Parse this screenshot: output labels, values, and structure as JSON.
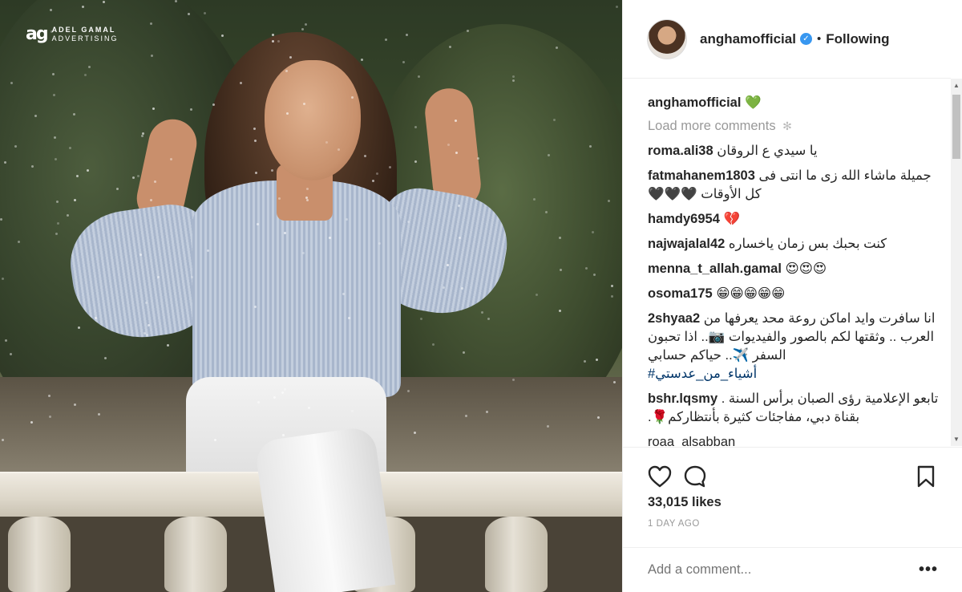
{
  "photo": {
    "brand_mark": "ag",
    "brand_line1": "ADEL GAMAL",
    "brand_line2": "ADVERTISING"
  },
  "header": {
    "username": "anghamofficial",
    "separator": "•",
    "follow_label": "Following"
  },
  "caption": {
    "username": "anghamofficial",
    "text": "💚"
  },
  "load_more": "Load more comments",
  "comments": [
    {
      "user": "roma.ali38",
      "text": "يا سيدي ع الروقان"
    },
    {
      "user": "fatmahanem1803",
      "text": "جميلة ماشاء الله زى ما انتى فى كل الأوقات 🖤🖤🖤"
    },
    {
      "user": "hamdy6954",
      "text": "💔"
    },
    {
      "user": "najwajalal42",
      "text": "كنت بحبك بس زمان ياخساره"
    },
    {
      "user": "menna_t_allah.gamal",
      "text": "😍😍😍"
    },
    {
      "user": "osoma175",
      "text": "😁😁😁😁😁"
    },
    {
      "user": "2shyaa2",
      "text": "انا سافرت وايد اماكن روعة محد يعرفها من العرب .. وثقتها لكم بالصور والفيديوات 📷.. اذا تحبون السفر ✈️.. حياكم حسابي",
      "hashtag": "#أشياء_من_عدستي"
    },
    {
      "user": "bshr.lqsmy",
      "text": "تابعو الإعلامية رؤى الصبان برأس السنة . بقناة دبي، مفاجئات كثيرة بأنتظاركم🌹."
    },
    {
      "user": "roaa_alsabban",
      "text": ""
    }
  ],
  "likes": "33,015 likes",
  "time_ago": "1 DAY AGO",
  "add_comment_placeholder": "Add a comment...",
  "more_options": "•••",
  "icons": {
    "like": "heart-icon",
    "comment": "comment-bubble-icon",
    "save": "bookmark-icon"
  },
  "colors": {
    "verified": "#3897f0",
    "muted": "#999999",
    "text": "#262626",
    "hashtag": "#003569"
  }
}
